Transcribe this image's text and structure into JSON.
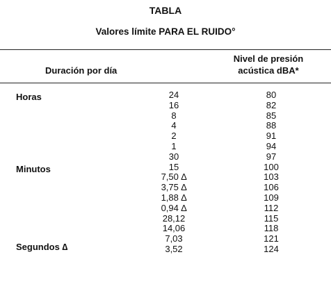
{
  "title": "TABLA",
  "subtitle": "Valores límite PARA EL RUIDO°",
  "headers": {
    "duration": "Duración por día",
    "level_line1": "Nivel de presión",
    "level_line2": "acústica dBA*"
  },
  "categories": {
    "hours": "Horas",
    "minutes": "Minutos",
    "seconds": "Segundos ∆"
  },
  "rows": [
    {
      "duration": "24",
      "level": "80"
    },
    {
      "duration": "16",
      "level": "82"
    },
    {
      "duration": "8",
      "level": "85"
    },
    {
      "duration": "4",
      "level": "88"
    },
    {
      "duration": "2",
      "level": "91"
    },
    {
      "duration": "1",
      "level": "94"
    },
    {
      "duration": "30",
      "level": "97"
    },
    {
      "duration": "15",
      "level": "100"
    },
    {
      "duration": "7,50 ∆",
      "level": "103"
    },
    {
      "duration": "3,75 ∆",
      "level": "106"
    },
    {
      "duration": "1,88 ∆",
      "level": "109"
    },
    {
      "duration": "0,94 ∆",
      "level": "112"
    },
    {
      "duration": "28,12",
      "level": "115"
    },
    {
      "duration": "14,06",
      "level": "118"
    },
    {
      "duration": "7,03",
      "level": "121"
    },
    {
      "duration": "3,52",
      "level": "124"
    }
  ]
}
